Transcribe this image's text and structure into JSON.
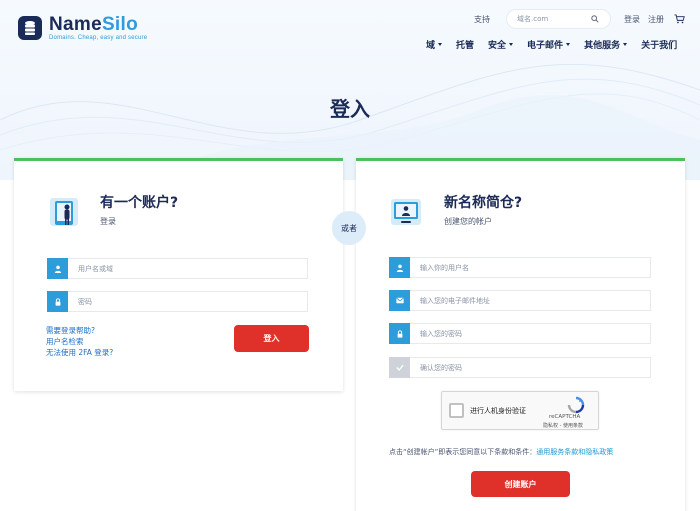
{
  "header": {
    "logo": {
      "name_part1": "Name",
      "name_part2": "Silo",
      "tagline": "Domains. Cheap, easy and secure"
    },
    "support_label": "支持",
    "search_placeholder": "域名.com",
    "login_label": "登录",
    "register_label": "注册",
    "nav": [
      {
        "label": "域",
        "has_caret": true
      },
      {
        "label": "托管",
        "has_caret": false
      },
      {
        "label": "安全",
        "has_caret": true
      },
      {
        "label": "电子邮件",
        "has_caret": true
      },
      {
        "label": "其他服务",
        "has_caret": true
      },
      {
        "label": "关于我们",
        "has_caret": false
      }
    ]
  },
  "page_title": "登入",
  "or_label": "或者",
  "login_card": {
    "title": "有一个账户?",
    "subtitle": "登录",
    "username_placeholder": "用户名或域",
    "password_placeholder": "密码",
    "help_links": [
      "需要登录帮助?",
      "用户名检索",
      "无法使用 2FA 登录?"
    ],
    "submit_label": "登入"
  },
  "register_card": {
    "title": "新名称简仓?",
    "subtitle": "创建您的帐户",
    "username_placeholder": "输入你的用户名",
    "email_placeholder": "输入您的电子邮件地址",
    "password_placeholder": "输入您的密码",
    "confirm_placeholder": "确认您的密码",
    "recaptcha": {
      "label": "进行人机身份验证",
      "brand": "reCAPTCHA",
      "terms": "隐私权 - 使用条款"
    },
    "terms_text": "点击“创建帐户”即表示您同意以下条款和条件：",
    "terms_link": "通用服务条款和隐私政策",
    "submit_label": "创建账户"
  },
  "colors": {
    "brand_navy": "#1b2b57",
    "accent_blue": "#2d9cdb",
    "card_top_green": "#4cc05a",
    "button_red": "#e0302a"
  }
}
